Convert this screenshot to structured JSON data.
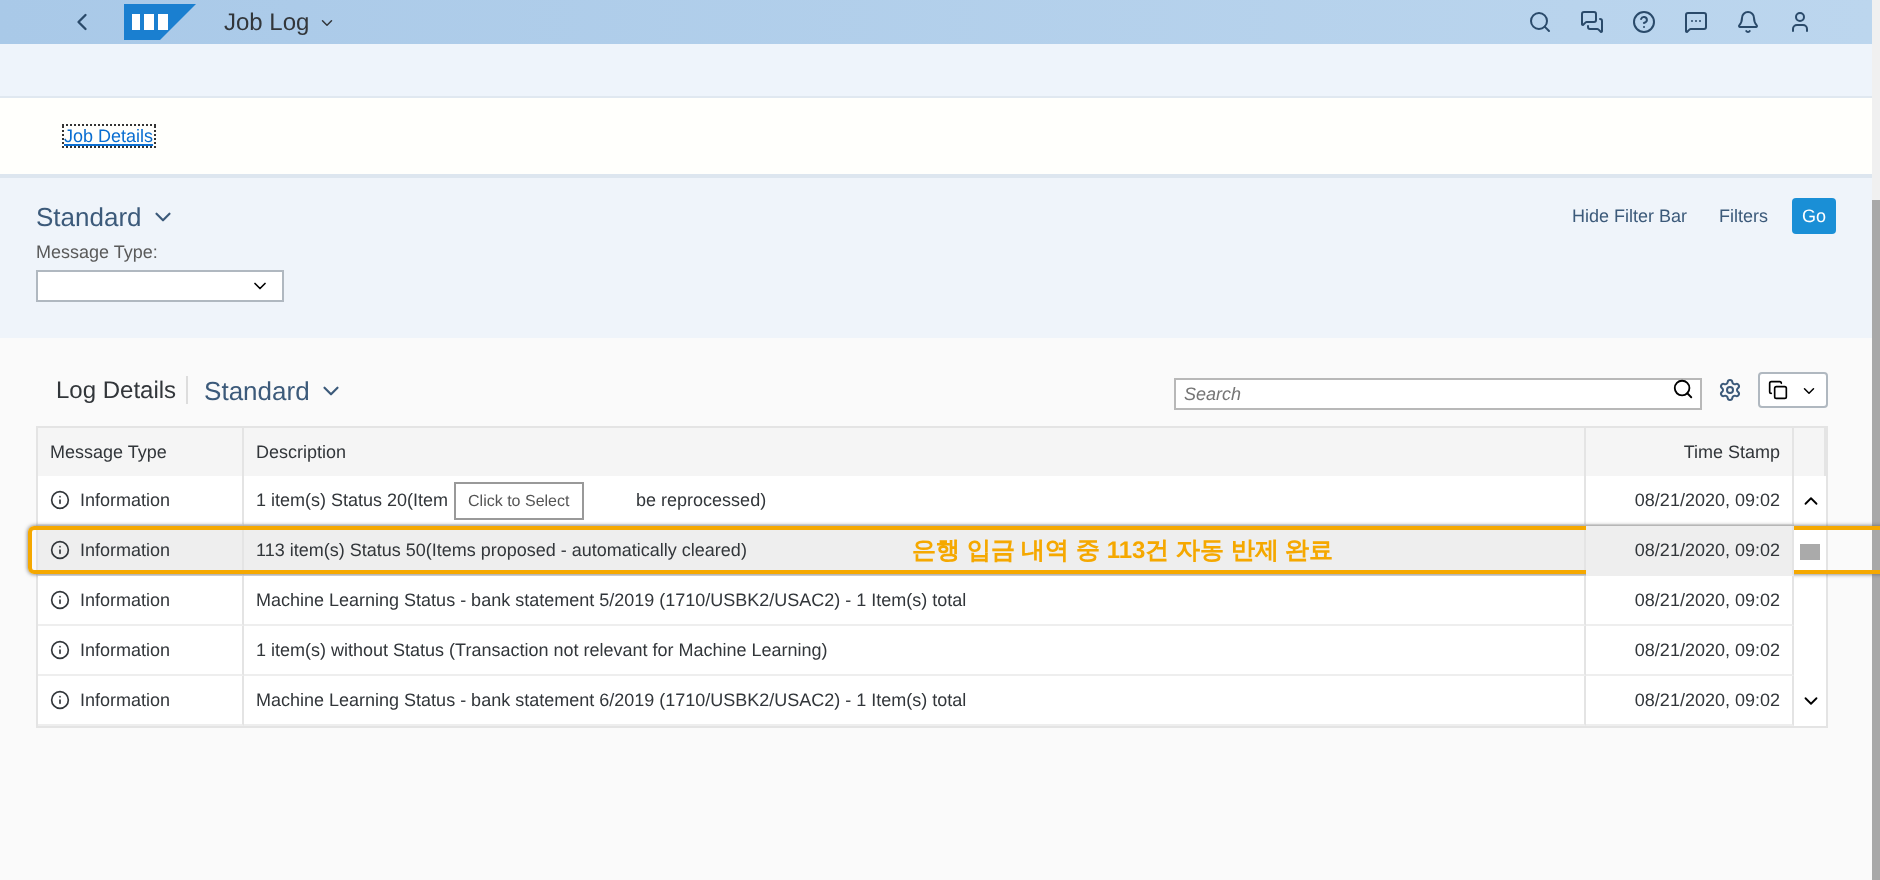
{
  "shell": {
    "title": "Job Log"
  },
  "header": {
    "link": "Job Details"
  },
  "filter_bar": {
    "variant": "Standard",
    "field_label": "Message Type:",
    "actions": [
      "Hide Filter Bar",
      "Filters"
    ],
    "go": "Go"
  },
  "log": {
    "title": "Log Details",
    "variant": "Standard",
    "search": {
      "placeholder": "Search"
    },
    "columns": [
      "Message Type",
      "Description",
      "Time Stamp"
    ],
    "rows": [
      {
        "type": "Information",
        "segments": [
          "1 item(s) Status 20(Item",
          "be reprocessed)"
        ],
        "tooltip": "Click to Select",
        "time": "08/21/2020, 09:02",
        "highlighted": false
      },
      {
        "type": "Information",
        "segments": [
          "113 item(s) Status 50(Items proposed - automatically cleared)"
        ],
        "time": "08/21/2020, 09:02",
        "highlighted": true,
        "note": "은행 입금 내역 중 113건 자동 반제 완료"
      },
      {
        "type": "Information",
        "segments": [
          "Machine Learning Status - bank statement 5/2019 (1710/USBK2/USAC2) - 1 Item(s) total"
        ],
        "time": "08/21/2020, 09:02",
        "highlighted": false
      },
      {
        "type": "Information",
        "segments": [
          "1 item(s) without Status (Transaction not relevant for Machine Learning)"
        ],
        "time": "08/21/2020, 09:02",
        "highlighted": false
      },
      {
        "type": "Information",
        "segments": [
          "Machine Learning Status - bank statement 6/2019 (1710/USBK2/USAC2) - 1 Item(s) total"
        ],
        "time": "08/21/2020, 09:02",
        "highlighted": false
      }
    ]
  }
}
